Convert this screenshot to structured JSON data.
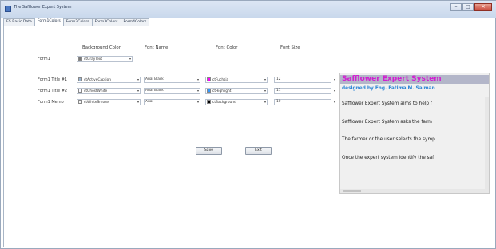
{
  "window": {
    "title": "The Safflower Expert System",
    "controls": {
      "minimize": "–",
      "maximize": "□",
      "close": "✕"
    },
    "icon": "app-icon"
  },
  "tabs": [
    {
      "label": "ES Basic Data",
      "active": false
    },
    {
      "label": "Form1Colors",
      "active": true
    },
    {
      "label": "Form2Colors",
      "active": false
    },
    {
      "label": "Form3Colors",
      "active": false
    },
    {
      "label": "Form4Colors",
      "active": false
    }
  ],
  "headers": {
    "background_color": "Background Color",
    "font_name": "Font Name",
    "font_color": "Font Color",
    "font_size": "Font Size"
  },
  "rows": {
    "form1": {
      "label": "Form1",
      "bg": {
        "name": "ctGrayText",
        "color": "#7a7a7a"
      }
    },
    "title1": {
      "label": "Form1 Title #1",
      "bg": {
        "name": "ctActiveCaption",
        "color": "#99b4d1"
      },
      "font": "Arial Black",
      "font_color": {
        "name": "ctFuchsia",
        "color": "#ff00ff"
      },
      "font_size": "12"
    },
    "title2": {
      "label": "Form1 Title #2",
      "bg": {
        "name": "ctGhostWhite",
        "color": "#f8f8ff"
      },
      "font": "Arial Black",
      "font_color": {
        "name": "ctHighlight",
        "color": "#3399ff"
      },
      "font_size": "11"
    },
    "memo": {
      "label": "Form1 Memo",
      "bg": {
        "name": "ctWhiteSmoke",
        "color": "#f5f5f5"
      },
      "font": "Arial",
      "font_color": {
        "name": "ctBackground",
        "color": "#000000"
      },
      "font_size": "10"
    }
  },
  "buttons": {
    "save": "Save",
    "exit": "Exit"
  },
  "preview": {
    "title": "Safflower Expert System",
    "author": "designed by Eng. Fatima M. Salman",
    "lines": [
      "Safflower Expert System aims to help f",
      "Safflower Expert System asks the farm",
      "The farmer or the user selects the symp",
      "Once the expert system identify the saf"
    ]
  }
}
